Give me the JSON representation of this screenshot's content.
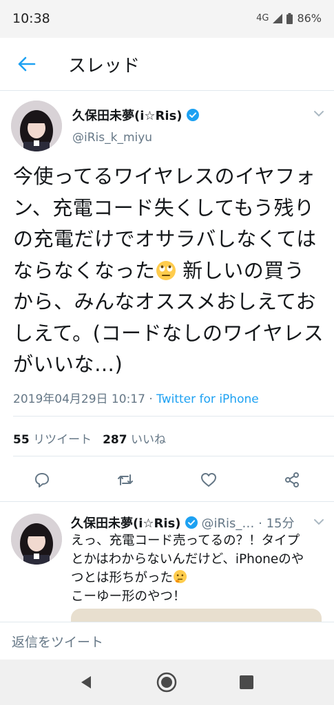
{
  "status_bar": {
    "time": "10:38",
    "network": "4G",
    "battery": "86%"
  },
  "header": {
    "title": "スレッド"
  },
  "tweet": {
    "display_name": "久保田未夢(i☆Ris)",
    "handle": "@iRis_k_miyu",
    "text_lines": [
      "今使ってるワイヤレスのイヤフォ",
      "ン、充電コード失くしてもう残り",
      "の充電だけでオサラバしなくては",
      "ならなくなった",
      " 新しいの買う",
      "から、みんなオススメおしえてお",
      "しえて。(コードなしのワイヤレス",
      "がいいな…)"
    ],
    "date": "2019年04月29日 10:17",
    "separator": " · ",
    "source": "Twitter for iPhone",
    "retweets_count": "55",
    "retweets_label": "リツイート",
    "likes_count": "287",
    "likes_label": "いいね"
  },
  "reply": {
    "display_name": "久保田未夢(i☆Ris)",
    "handle_time": "@iRis_… · 15分",
    "text_lines": [
      "えっ、充電コード売ってるの？！タイプ",
      "とかはわからないんだけど、iPhoneのや",
      "つとは形ちがった",
      "こーゆー形のやつ！"
    ]
  },
  "reply_bar": {
    "placeholder": "返信をツイート"
  },
  "colors": {
    "accent": "#1da1f2",
    "muted": "#657786",
    "text": "#14171a"
  }
}
